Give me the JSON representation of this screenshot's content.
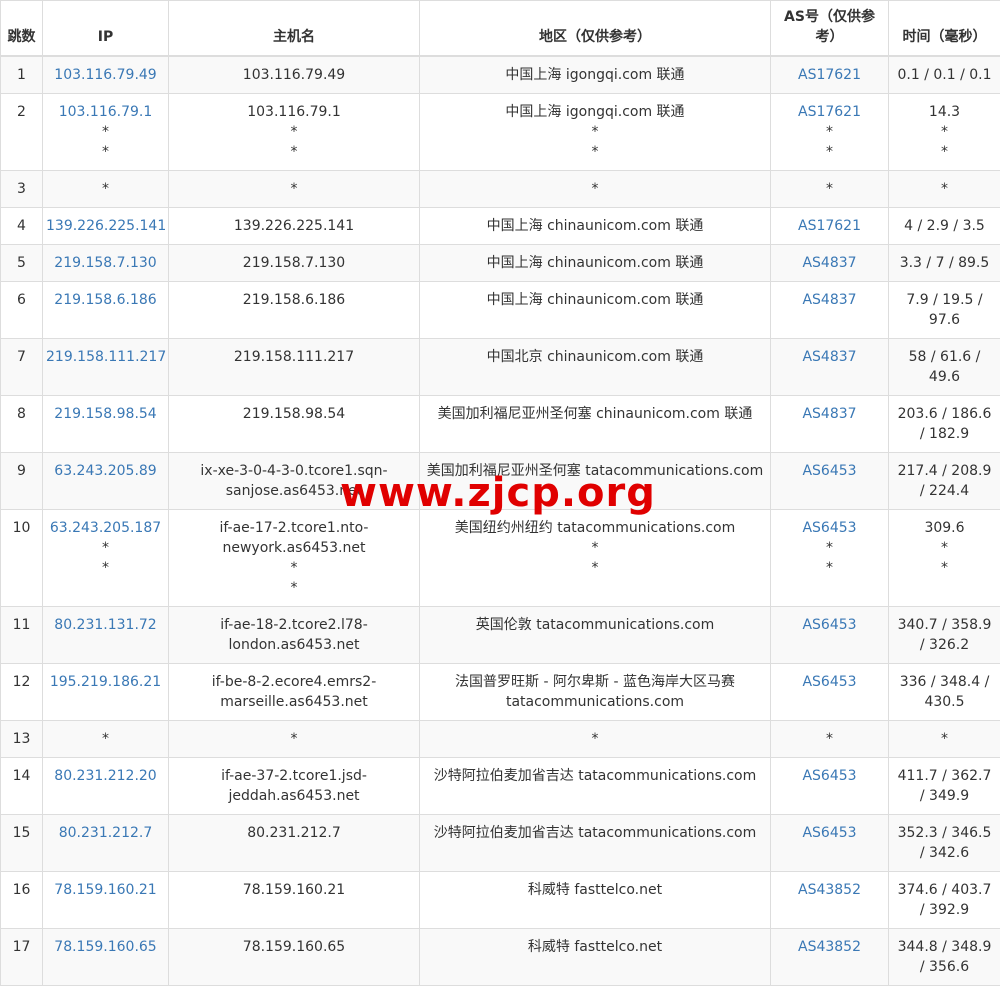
{
  "headers": {
    "hop": "跳数",
    "ip": "IP",
    "host": "主机名",
    "geo": "地区（仅供参考）",
    "as": "AS号（仅供参考）",
    "time": "时间（毫秒）"
  },
  "watermark": "www.zjcp.org",
  "colors": {
    "link": "#3a78b5",
    "watermark": "#e00000"
  },
  "rows": [
    {
      "hop": "1",
      "ip": [
        "103.116.79.49"
      ],
      "host": [
        "103.116.79.49"
      ],
      "geo": [
        "中国上海 igongqi.com 联通"
      ],
      "as": [
        "AS17621"
      ],
      "time": [
        "0.1 / 0.1 / 0.1"
      ]
    },
    {
      "hop": "2",
      "ip": [
        "103.116.79.1",
        "*",
        "*"
      ],
      "host": [
        "103.116.79.1",
        "*",
        "*"
      ],
      "geo": [
        "中国上海 igongqi.com 联通",
        "*",
        "*"
      ],
      "as": [
        "AS17621",
        "*",
        "*"
      ],
      "time": [
        "14.3",
        "*",
        "*"
      ]
    },
    {
      "hop": "3",
      "ip": [
        "*"
      ],
      "host": [
        "*"
      ],
      "geo": [
        "*"
      ],
      "as": [
        "*"
      ],
      "time": [
        "*"
      ]
    },
    {
      "hop": "4",
      "ip": [
        "139.226.225.141"
      ],
      "host": [
        "139.226.225.141"
      ],
      "geo": [
        "中国上海 chinaunicom.com 联通"
      ],
      "as": [
        "AS17621"
      ],
      "time": [
        "4 / 2.9 / 3.5"
      ]
    },
    {
      "hop": "5",
      "ip": [
        "219.158.7.130"
      ],
      "host": [
        "219.158.7.130"
      ],
      "geo": [
        "中国上海 chinaunicom.com 联通"
      ],
      "as": [
        "AS4837"
      ],
      "time": [
        "3.3 / 7 / 89.5"
      ]
    },
    {
      "hop": "6",
      "ip": [
        "219.158.6.186"
      ],
      "host": [
        "219.158.6.186"
      ],
      "geo": [
        "中国上海 chinaunicom.com 联通"
      ],
      "as": [
        "AS4837"
      ],
      "time": [
        "7.9 / 19.5 /",
        "97.6"
      ]
    },
    {
      "hop": "7",
      "ip": [
        "219.158.111.217"
      ],
      "host": [
        "219.158.111.217"
      ],
      "geo": [
        "中国北京 chinaunicom.com 联通"
      ],
      "as": [
        "AS4837"
      ],
      "time": [
        "58 / 61.6 /",
        "49.6"
      ]
    },
    {
      "hop": "8",
      "ip": [
        "219.158.98.54"
      ],
      "host": [
        "219.158.98.54"
      ],
      "geo": [
        "美国加利福尼亚州圣何塞 chinaunicom.com 联通"
      ],
      "as": [
        "AS4837"
      ],
      "time": [
        "203.6 / 186.6",
        "/ 182.9"
      ]
    },
    {
      "hop": "9",
      "ip": [
        "63.243.205.89"
      ],
      "host": [
        "ix-xe-3-0-4-3-0.tcore1.sqn-",
        "sanjose.as6453.net"
      ],
      "geo": [
        "美国加利福尼亚州圣何塞 tatacommunications.com"
      ],
      "as": [
        "AS6453"
      ],
      "time": [
        "217.4 / 208.9",
        "/ 224.4"
      ]
    },
    {
      "hop": "10",
      "ip": [
        "63.243.205.187",
        "*",
        "*"
      ],
      "host": [
        "if-ae-17-2.tcore1.nto-",
        "newyork.as6453.net",
        "*",
        "*"
      ],
      "geo": [
        "美国纽约州纽约 tatacommunications.com",
        "*",
        "*"
      ],
      "as": [
        "AS6453",
        "*",
        "*"
      ],
      "time": [
        "309.6",
        "*",
        "*"
      ]
    },
    {
      "hop": "11",
      "ip": [
        "80.231.131.72"
      ],
      "host": [
        "if-ae-18-2.tcore2.l78-",
        "london.as6453.net"
      ],
      "geo": [
        "英国伦敦 tatacommunications.com"
      ],
      "as": [
        "AS6453"
      ],
      "time": [
        "340.7 / 358.9",
        "/ 326.2"
      ]
    },
    {
      "hop": "12",
      "ip": [
        "195.219.186.21"
      ],
      "host": [
        "if-be-8-2.ecore4.emrs2-",
        "marseille.as6453.net"
      ],
      "geo": [
        "法国普罗旺斯 - 阿尔卑斯 - 蓝色海岸大区马赛",
        "tatacommunications.com"
      ],
      "as": [
        "AS6453"
      ],
      "time": [
        "336 / 348.4 /",
        "430.5"
      ]
    },
    {
      "hop": "13",
      "ip": [
        "*"
      ],
      "host": [
        "*"
      ],
      "geo": [
        "*"
      ],
      "as": [
        "*"
      ],
      "time": [
        "*"
      ]
    },
    {
      "hop": "14",
      "ip": [
        "80.231.212.20"
      ],
      "host": [
        "if-ae-37-2.tcore1.jsd-",
        "jeddah.as6453.net"
      ],
      "geo": [
        "沙特阿拉伯麦加省吉达 tatacommunications.com"
      ],
      "as": [
        "AS6453"
      ],
      "time": [
        "411.7 / 362.7",
        "/ 349.9"
      ]
    },
    {
      "hop": "15",
      "ip": [
        "80.231.212.7"
      ],
      "host": [
        "80.231.212.7"
      ],
      "geo": [
        "沙特阿拉伯麦加省吉达 tatacommunications.com"
      ],
      "as": [
        "AS6453"
      ],
      "time": [
        "352.3 / 346.5",
        "/ 342.6"
      ]
    },
    {
      "hop": "16",
      "ip": [
        "78.159.160.21"
      ],
      "host": [
        "78.159.160.21"
      ],
      "geo": [
        "科威特 fasttelco.net"
      ],
      "as": [
        "AS43852"
      ],
      "time": [
        "374.6 / 403.7",
        "/ 392.9"
      ]
    },
    {
      "hop": "17",
      "ip": [
        "78.159.160.65"
      ],
      "host": [
        "78.159.160.65"
      ],
      "geo": [
        "科威特 fasttelco.net"
      ],
      "as": [
        "AS43852"
      ],
      "time": [
        "344.8 / 348.9",
        "/ 356.6"
      ]
    }
  ]
}
